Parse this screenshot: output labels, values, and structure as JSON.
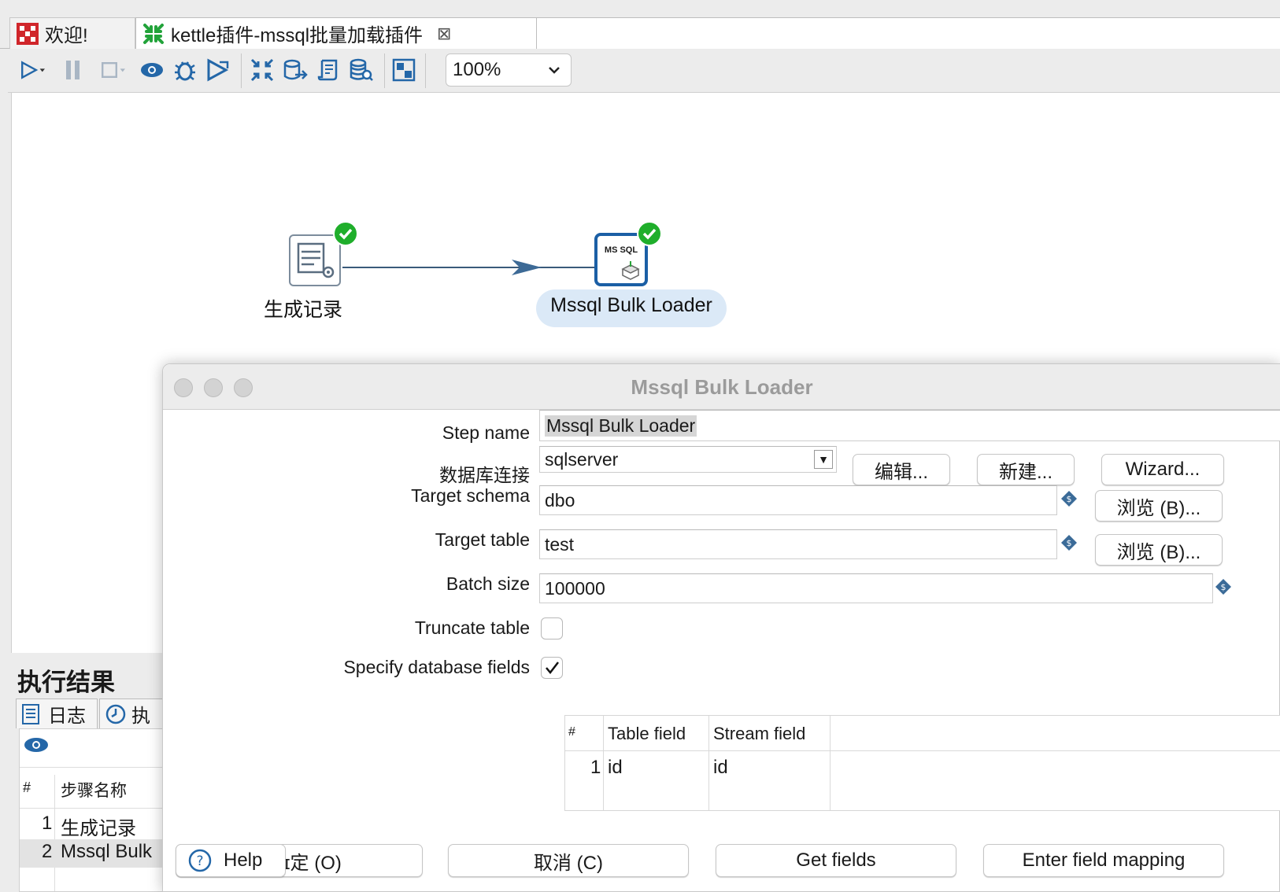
{
  "tabs": [
    {
      "label": "欢迎!"
    },
    {
      "label": "kettle插件-mssql批量加载插件"
    }
  ],
  "toolbar": {
    "zoom_value": "100%"
  },
  "canvas": {
    "step1_label": "生成记录",
    "step2_label": "Mssql Bulk Loader",
    "step2_icon_text": "MS SQL"
  },
  "results": {
    "title": "执行结果",
    "tab_log": "日志",
    "tab_exec": "执",
    "col_num": "#",
    "col_step": "步骤名称",
    "rows": [
      {
        "num": "1",
        "name": "生成记录"
      },
      {
        "num": "2",
        "name": "Mssql Bulk"
      }
    ]
  },
  "dialog": {
    "title": "Mssql Bulk Loader",
    "step_name_label": "Step name",
    "step_name_value": "Mssql Bulk Loader",
    "db_conn_label": "数据库连接",
    "db_conn_value": "sqlserver",
    "edit_btn": "编辑...",
    "new_btn": "新建...",
    "wizard_btn": "Wizard...",
    "schema_label": "Target schema",
    "schema_value": "dbo",
    "browse_btn": "浏览 (B)...",
    "table_label": "Target table",
    "table_value": "test",
    "batch_label": "Batch size",
    "batch_value": "100000",
    "truncate_label": "Truncate table",
    "truncate_checked": false,
    "specify_label": "Specify database fields",
    "specify_checked": true,
    "grid": {
      "col_num": "#",
      "col_table": "Table field",
      "col_stream": "Stream field",
      "rows": [
        {
          "num": "1",
          "table_field": "id",
          "stream_field": "id"
        }
      ]
    },
    "help_btn": "Help",
    "ok_btn": "确定 (O)",
    "ok_btn_visible": "ɪ定 (O)",
    "cancel_btn": "取消 (C)",
    "getfields_btn": "Get fields",
    "mapping_btn": "Enter field mapping"
  },
  "colors": {
    "accent_blue": "#1b5fa5",
    "check_green": "#1fae2b",
    "dollar_blue": "#3b6b98"
  }
}
